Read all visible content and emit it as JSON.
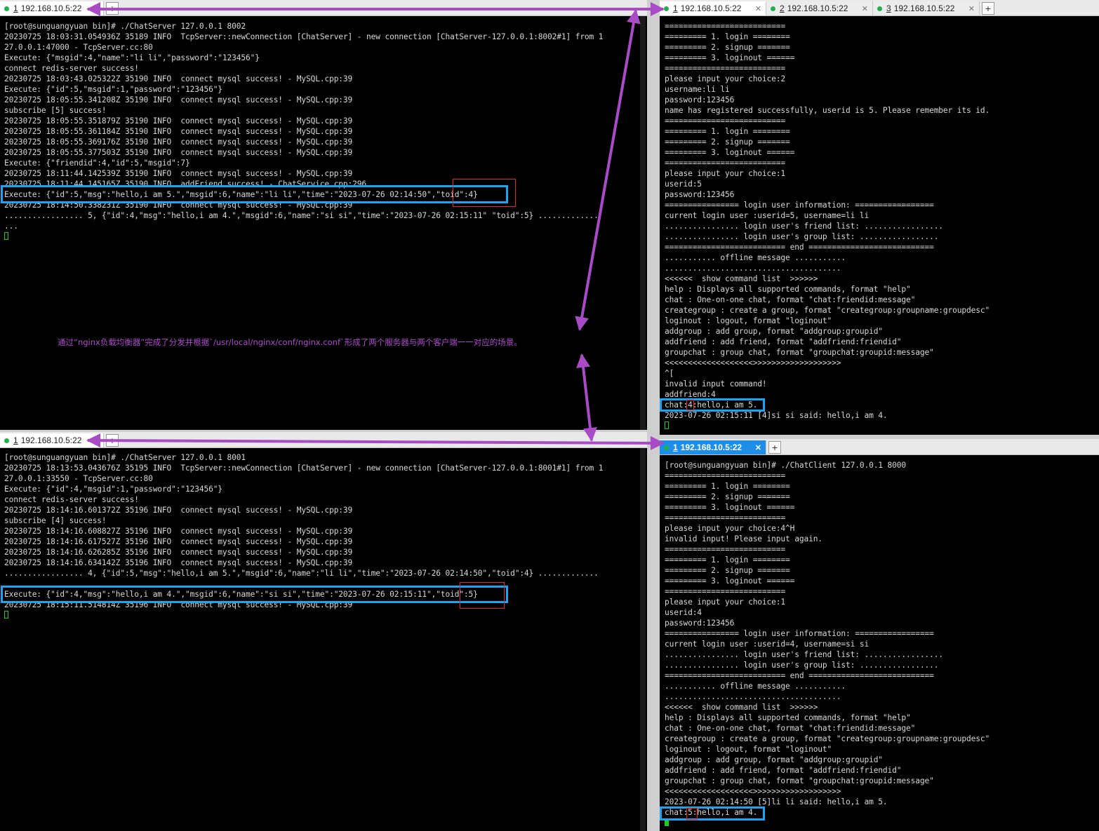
{
  "panes": {
    "top_left": {
      "tab": {
        "num": "1",
        "host": "192.168.10.5:22"
      },
      "lines": [
        "[root@sunguangyuan bin]# ./ChatServer 127.0.0.1 8002",
        "20230725 18:03:31.054936Z 35189 INFO  TcpServer::newConnection [ChatServer] - new connection [ChatServer-127.0.0.1:8002#1] from 1",
        "27.0.0.1:47000 - TcpServer.cc:80",
        "Execute: {\"msgid\":4,\"name\":\"li li\",\"password\":\"123456\"}",
        "connect redis-server success!",
        "20230725 18:03:43.025322Z 35190 INFO  connect mysql success! - MySQL.cpp:39",
        "Execute: {\"id\":5,\"msgid\":1,\"password\":\"123456\"}",
        "20230725 18:05:55.341208Z 35190 INFO  connect mysql success! - MySQL.cpp:39",
        "subscribe [5] success!",
        "20230725 18:05:55.351879Z 35190 INFO  connect mysql success! - MySQL.cpp:39",
        "20230725 18:05:55.361184Z 35190 INFO  connect mysql success! - MySQL.cpp:39",
        "20230725 18:05:55.369176Z 35190 INFO  connect mysql success! - MySQL.cpp:39",
        "20230725 18:05:55.377503Z 35190 INFO  connect mysql success! - MySQL.cpp:39",
        "Execute: {\"friendid\":4,\"id\":5,\"msgid\":7}",
        "20230725 18:11:44.142539Z 35190 INFO  connect mysql success! - MySQL.cpp:39",
        "20230725 18:11:44.145165Z 35190 INFO  addFriend success! - ChatService.cpp:296",
        "Execute: {\"id\":5,\"msg\":\"hello,i am 5.\",\"msgid\":6,\"name\":\"li li\",\"time\":\"2023-07-26 02:14:50\",\"toid\":4}",
        "20230725 18:14:50.338231Z 35190 INFO  connect mysql success! - MySQL.cpp:39",
        "................. 5, {\"id\":4,\"msg\":\"hello,i am 4.\",\"msgid\":6,\"name\":\"si si\",\"time\":\"2023-07-26 02:15:11\" \"toid\":5} .............",
        "..."
      ]
    },
    "bottom_left": {
      "tab": {
        "num": "1",
        "host": "192.168.10.5:22"
      },
      "lines": [
        "[root@sunguangyuan bin]# ./ChatServer 127.0.0.1 8001",
        "20230725 18:13:53.043676Z 35195 INFO  TcpServer::newConnection [ChatServer] - new connection [ChatServer-127.0.0.1:8001#1] from 1",
        "27.0.0.1:33550 - TcpServer.cc:80",
        "Execute: {\"id\":4,\"msgid\":1,\"password\":\"123456\"}",
        "connect redis-server success!",
        "20230725 18:14:16.601372Z 35196 INFO  connect mysql success! - MySQL.cpp:39",
        "subscribe [4] success!",
        "20230725 18:14:16.608827Z 35196 INFO  connect mysql success! - MySQL.cpp:39",
        "20230725 18:14:16.617527Z 35196 INFO  connect mysql success! - MySQL.cpp:39",
        "20230725 18:14:16.626285Z 35196 INFO  connect mysql success! - MySQL.cpp:39",
        "20230725 18:14:16.634142Z 35196 INFO  connect mysql success! - MySQL.cpp:39",
        "................. 4, {\"id\":5,\"msg\":\"hello,i am 5.\",\"msgid\":6,\"name\":\"li li\",\"time\":\"2023-07-26 02:14:50\",\"toid\":4} .............",
        "",
        "Execute: {\"id\":4,\"msg\":\"hello,i am 4.\",\"msgid\":6,\"name\":\"si si\",\"time\":\"2023-07-26 02:15:11\",\"toid\":5}",
        "20230725 18:15:11.514814Z 35196 INFO  connect mysql success! - MySQL.cpp:39"
      ]
    },
    "top_right": {
      "tabs": [
        {
          "num": "1",
          "host": "192.168.10.5:22"
        },
        {
          "num": "2",
          "host": "192.168.10.5:22"
        },
        {
          "num": "3",
          "host": "192.168.10.5:22"
        }
      ],
      "lines": [
        "==========================",
        "========= 1. login ========",
        "========= 2. signup =======",
        "========= 3. loginout ======",
        "==========================",
        "please input your choice:2",
        "username:li li",
        "password:123456",
        "name has registered successfully, userid is 5. Please remember its id.",
        "==========================",
        "========= 1. login ========",
        "========= 2. signup =======",
        "========= 3. loginout ======",
        "==========================",
        "please input your choice:1",
        "userid:5",
        "password:123456",
        "================ login user information: =================",
        "current login user :userid=5, username=li li",
        "................ login user's friend list: .................",
        "................ login user's group list: .................",
        "========================== end ===========================",
        "........... offline message ...........",
        "......................................",
        "<<<<<<  show command list  >>>>>>",
        "help : Displays all supported commands, format \"help\"",
        "chat : One-on-one chat, format \"chat:friendid:message\"",
        "creategroup : create a group, format \"creategroup:groupname:groupdesc\"",
        "loginout : logout, format \"loginout\"",
        "addgroup : add group, format \"addgroup:groupid\"",
        "addfriend : add friend, format \"addfriend:friendid\"",
        "groupchat : group chat, format \"groupchat:groupid:message\"",
        "<<<<<<<<<<<<<<<<<<<>>>>>>>>>>>>>>>>>>>",
        "^[",
        "invalid input command!",
        "addfriend:4",
        "chat:4:hello,i am 5.",
        "2023-07-26 02:15:11 [4]si si said: hello,i am 4."
      ]
    },
    "bottom_right": {
      "tab": {
        "num": "1",
        "host": "192.168.10.5:22"
      },
      "lines": [
        "[root@sunguangyuan bin]# ./ChatClient 127.0.0.1 8000",
        "==========================",
        "========= 1. login ========",
        "========= 2. signup =======",
        "========= 3. loginout ======",
        "==========================",
        "please input your choice:4^H",
        "invalid input! Please input again.",
        "==========================",
        "========= 1. login ========",
        "========= 2. signup =======",
        "========= 3. loginout ======",
        "==========================",
        "please input your choice:1",
        "userid:4",
        "password:123456",
        "================ login user information: =================",
        "current login user :userid=4, username=si si",
        "................ login user's friend list: .................",
        "................ login user's group list: .................",
        "========================== end ===========================",
        "........... offline message ...........",
        "......................................",
        "<<<<<<  show command list  >>>>>>",
        "help : Displays all supported commands, format \"help\"",
        "chat : One-on-one chat, format \"chat:friendid:message\"",
        "creategroup : create a group, format \"creategroup:groupname:groupdesc\"",
        "loginout : logout, format \"loginout\"",
        "addgroup : add group, format \"addgroup:groupid\"",
        "addfriend : add friend, format \"addfriend:friendid\"",
        "groupchat : group chat, format \"groupchat:groupid:message\"",
        "<<<<<<<<<<<<<<<<<<<>>>>>>>>>>>>>>>>>>>",
        "2023-07-26 02:14:50 [5]li li said: hello,i am 5.",
        "chat:5:hello,i am 4."
      ]
    }
  },
  "annotation": {
    "text": "通过“nginx负载均衡器”完成了分发并根据`/usr/local/nginx/conf/nginx.conf`形成了两个服务器与两个客户端一一对应的场景。",
    "arrow_color": "#a94bc6",
    "highlight_color": "#1ea4ef",
    "mark_color": "#e8262a"
  },
  "colors": {
    "terminal_bg": "#000000",
    "terminal_fg": "#d8d8d8",
    "cursor": "#18d018",
    "tab_active": "#1e8fe8",
    "connected_dot": "#21b14b"
  }
}
